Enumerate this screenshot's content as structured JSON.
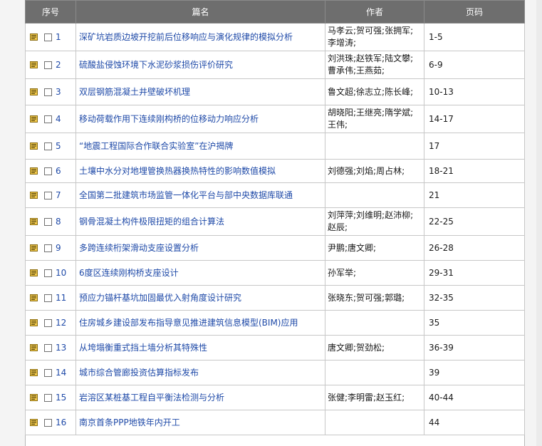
{
  "header": {
    "index": "序号",
    "title": "篇名",
    "author": "作者",
    "pages": "页码"
  },
  "colors": {
    "header_bg": "#6e6e6e",
    "link": "#1f4aa8",
    "icon_fill": "#f2c94c"
  },
  "rows": [
    {
      "index": "1",
      "title": "深矿坑岩质边坡开挖前后位移响应与演化规律的模拟分析",
      "author": "马孝云;贺可强;张拥军;李增涛;",
      "pages": "1-5"
    },
    {
      "index": "2",
      "title": "硫酸盐侵蚀环境下水泥砂浆损伤评价研究",
      "author": "刘洪珠;赵铁军;陆文攀;曹承伟;王燕茹;",
      "pages": "6-9"
    },
    {
      "index": "3",
      "title": "双层钢筋混凝土井壁破坏机理",
      "author": "鲁文超;徐志立;陈长峰;",
      "pages": "10-13"
    },
    {
      "index": "4",
      "title": "移动荷载作用下连续刚构桥的位移动力响应分析",
      "author": "胡晓阳;王继亮;隋学斌;王伟;",
      "pages": "14-17"
    },
    {
      "index": "5",
      "title": "“地震工程国际合作联合实验室”在沪揭牌",
      "author": "",
      "pages": "17"
    },
    {
      "index": "6",
      "title": "土壤中水分对地埋管换热器换热特性的影响数值模拟",
      "author": "刘德强;刘焰;周占林;",
      "pages": "18-21"
    },
    {
      "index": "7",
      "title": "全国第二批建筑市场监管一体化平台与部中央数据库联通",
      "author": "",
      "pages": "21"
    },
    {
      "index": "8",
      "title": "钢骨混凝土构件极限扭矩的组合计算法",
      "author": "刘萍萍;刘维明;赵沛柳;赵辰;",
      "pages": "22-25"
    },
    {
      "index": "9",
      "title": "多跨连续桁架滑动支座设置分析",
      "author": "尹鹏;唐文卿;",
      "pages": "26-28"
    },
    {
      "index": "10",
      "title": "6度区连续刚构桥支座设计",
      "author": "孙军举;",
      "pages": "29-31"
    },
    {
      "index": "11",
      "title": "预应力锚杆基坑加固最优入射角度设计研究",
      "author": "张晓东;贺可强;郭璐;",
      "pages": "32-35"
    },
    {
      "index": "12",
      "title": "住房城乡建设部发布指导意见推进建筑信息模型(BIM)应用",
      "author": "",
      "pages": "35"
    },
    {
      "index": "13",
      "title": "从垮塌衡重式挡土墙分析其特殊性",
      "author": "唐文卿;贺劲松;",
      "pages": "36-39"
    },
    {
      "index": "14",
      "title": "城市综合管廊投资估算指标发布",
      "author": "",
      "pages": "39"
    },
    {
      "index": "15",
      "title": "岩溶区某桩基工程自平衡法检测与分析",
      "author": "张健;李明雷;赵玉红;",
      "pages": "40-44"
    },
    {
      "index": "16",
      "title": "南京首条PPP地铁年内开工",
      "author": "",
      "pages": "44"
    }
  ]
}
